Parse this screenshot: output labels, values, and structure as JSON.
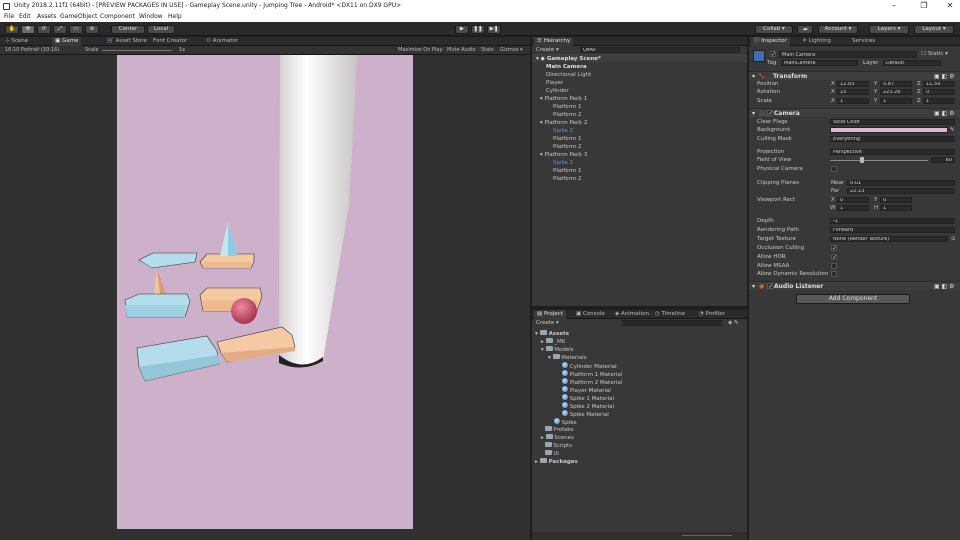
{
  "window": {
    "title": "Unity 2018.2.11f1 (64bit) - [PREVIEW PACKAGES IN USE] - Gameplay Scene.unity - Jumping Tree - Android* <DX11 on DX9 GPU>",
    "min": "–",
    "max": "❐",
    "close": "✕"
  },
  "menu": [
    "File",
    "Edit",
    "Assets",
    "GameObject",
    "Component",
    "Window",
    "Help"
  ],
  "toolbar": {
    "pivot": "Center",
    "space": "Local",
    "collab": "Collab ▾",
    "account": "Account ▾",
    "layers": "Layers ▾",
    "layout": "Layout ▾"
  },
  "scene_tabs": {
    "scene": "Scene",
    "game": "Game",
    "asset_store": "Asset Store",
    "font_creator": "Font Creator",
    "animator": "Animator"
  },
  "game_bar": {
    "display": "16:10 Portrait (10:16)",
    "scale_label": "Scale",
    "scale_value": "1x",
    "maximize": "Maximize On Play",
    "mute": "Mute Audio",
    "stats": "Stats",
    "gizmos": "Gizmos ▾"
  },
  "hierarchy": {
    "tab": "Hierarchy",
    "create": "Create ▾",
    "search_placeholder": "Q▾All",
    "scene": "Gameplay Scene*",
    "items": [
      "Main Camera",
      "Directional Light",
      "Player",
      "Cylinder",
      "Platform Pack 1",
      "Platform 1",
      "Platform 2",
      "Platform Pack 2",
      "Spike 2",
      "Platform 1",
      "Platform 2",
      "Platform Pack 3",
      "Spike 1",
      "Platform 1",
      "Platform 2"
    ]
  },
  "project": {
    "tabs": [
      "Project",
      "Console",
      "Animation",
      "Timeline",
      "Profiler"
    ],
    "create": "Create ▾",
    "items": [
      "Assets",
      "_MK",
      "Models",
      "Materials",
      "Cylinder Material",
      "Platform 1 Material",
      "Platform 2 Material",
      "Player Material",
      "Spike 1 Material",
      "Spike 2 Material",
      "Spike Material",
      "Spike",
      "Prefabs",
      "Scenes",
      "Scripts",
      "UI",
      "Packages"
    ]
  },
  "inspector": {
    "tabs": [
      "Inspector",
      "Lighting",
      "Services"
    ],
    "object_name": "Main Camera",
    "static": "Static ▾",
    "tag_label": "Tag",
    "tag": "MainCamera",
    "layer_label": "Layer",
    "layer": "Default",
    "transform": {
      "title": "Transform",
      "rows": [
        {
          "label": "Position",
          "x": "12.83",
          "y": "5.87",
          "z": "11.59"
        },
        {
          "label": "Rotation",
          "x": "15",
          "y": "223.26",
          "z": "0"
        },
        {
          "label": "Scale",
          "x": "1",
          "y": "1",
          "z": "1"
        }
      ]
    },
    "camera": {
      "title": "Camera",
      "clear_flags_label": "Clear Flags",
      "clear_flags": "Solid Color",
      "background_label": "Background",
      "background_color": "#ddb8cf",
      "culling_mask_label": "Culling Mask",
      "culling_mask": "Everything",
      "projection_label": "Projection",
      "projection": "Perspective",
      "fov_label": "Field of View",
      "fov": "60",
      "fov_level": 0.33,
      "physical_label": "Physical Camera",
      "clipping_label": "Clipping Planes",
      "near_label": "Near",
      "near": "0.01",
      "far_label": "Far",
      "far": "22.13",
      "viewport_label": "Viewport Rect",
      "vx": "0",
      "vy": "0",
      "vw": "1",
      "vh": "1",
      "depth_label": "Depth",
      "depth": "-1",
      "rendering_label": "Rendering Path",
      "rendering": "Forward",
      "target_label": "Target Texture",
      "target": "None (Render Texture)",
      "occlusion_label": "Occlusion Culling",
      "hdr_label": "Allow HDR",
      "msaa_label": "Allow MSAA",
      "dynres_label": "Allow Dynamic Resolution"
    },
    "audio_listener": "Audio Listener",
    "add_component": "Add Component"
  },
  "game_view": {
    "bg_color": "#cdb0c9",
    "letterbox": "#303030"
  }
}
